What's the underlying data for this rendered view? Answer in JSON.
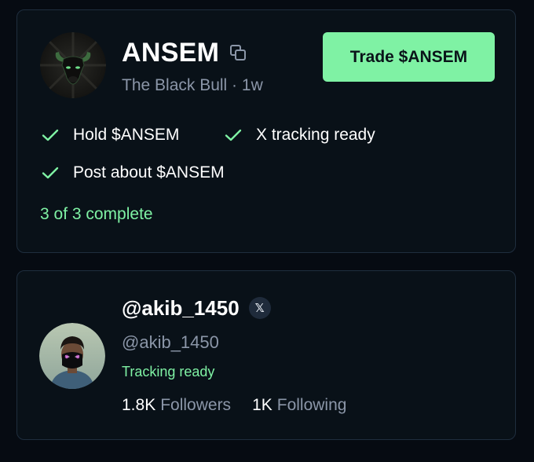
{
  "token": {
    "name": "ANSEM",
    "subtitle": "The Black Bull · 1w",
    "trade_button_label": "Trade $ANSEM",
    "requirements": [
      {
        "label": "Hold $ANSEM",
        "status": "complete"
      },
      {
        "label": "X tracking ready",
        "status": "complete"
      },
      {
        "label": "Post about $ANSEM",
        "status": "complete"
      }
    ],
    "progress_text": "3 of 3 complete",
    "avatar_icon": "black-bull-icon",
    "copy_icon": "copy-icon",
    "check_icon": "check-icon"
  },
  "user": {
    "handle": "@akib_1450",
    "username": "@akib_1450",
    "platform_badge": "𝕏",
    "tracking_status": "Tracking ready",
    "followers_value": "1.8K",
    "followers_label": "Followers",
    "following_value": "1K",
    "following_label": "Following",
    "avatar_icon": "user-avatar-icon"
  },
  "colors": {
    "background": "#060b12",
    "card_background": "#091118",
    "card_border": "#1f2e3e",
    "accent_green": "#7ff2a4",
    "muted_text": "#8b96a8",
    "primary_text": "#ffffff"
  }
}
